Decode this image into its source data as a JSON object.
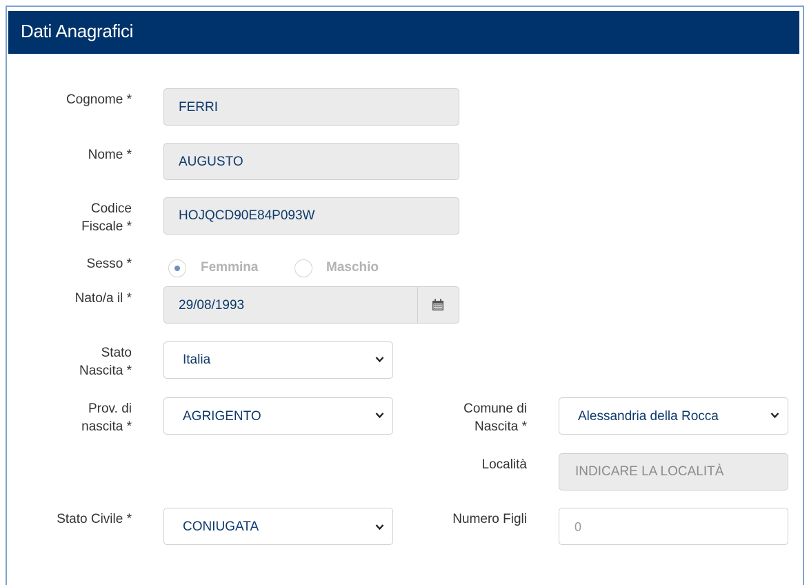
{
  "panel": {
    "title": "Dati Anagrafici"
  },
  "form": {
    "cognome": {
      "label": "Cognome *",
      "value": "FERRI"
    },
    "nome": {
      "label": "Nome *",
      "value": "AUGUSTO"
    },
    "codice_fiscale": {
      "label_line1": "Codice",
      "label_line2": "Fiscale *",
      "value": "HOJQCD90E84P093W"
    },
    "sesso": {
      "label": "Sesso *",
      "options": [
        {
          "label": "Femmina",
          "selected": true
        },
        {
          "label": "Maschio",
          "selected": false
        }
      ]
    },
    "nato_il": {
      "label": "Nato/a il *",
      "value": "29/08/1993",
      "icon": "calendar-icon"
    },
    "stato_nascita": {
      "label_line1": "Stato",
      "label_line2": "Nascita *",
      "value": "Italia"
    },
    "prov_nascita": {
      "label_line1": "Prov. di",
      "label_line2": "nascita *",
      "value": "AGRIGENTO"
    },
    "comune_nascita": {
      "label_line1": "Comune di",
      "label_line2": "Nascita *",
      "value": "Alessandria della Rocca"
    },
    "localita": {
      "label": "Località",
      "placeholder": "INDICARE LA LOCALITÀ"
    },
    "stato_civile": {
      "label": "Stato Civile *",
      "value": "CONIUGATA"
    },
    "numero_figli": {
      "label": "Numero Figli",
      "placeholder": "0"
    }
  },
  "colors": {
    "header_bg": "#00336b",
    "field_text": "#0d3a6b",
    "readonly_bg": "#ebebeb",
    "radio_dot": "#6f8fbe"
  }
}
